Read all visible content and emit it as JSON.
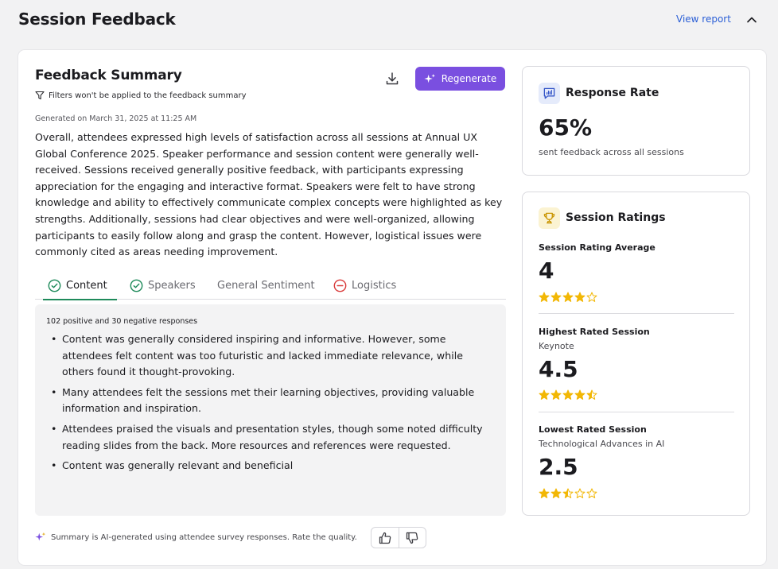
{
  "header": {
    "title": "Session Feedback",
    "view_report": "View report",
    "collapse_icon": "chevron-up-icon"
  },
  "summary": {
    "title": "Feedback Summary",
    "filter_note": "Filters won't be applied to the feedback summary",
    "download_icon": "download-icon",
    "regenerate_label": "Regenerate",
    "generated_on": "Generated on March 31, 2025 at 11:25 AM",
    "text": "Overall, attendees expressed high levels of satisfaction across all sessions at Annual UX Global Conference 2025. Speaker performance and session content were generally well-received. Sessions received generally positive feedback, with participants expressing appreciation for the engaging and interactive format. Speakers were felt to have strong knowledge and ability to effectively communicate complex concepts were highlighted as key strengths. Additionally, sessions had clear objectives and were well-organized, allowing participants to easily follow along and grasp the content. However, logistical issues were commonly cited as areas needing improvement."
  },
  "tabs": [
    {
      "label": "Content",
      "status": "positive",
      "active": true
    },
    {
      "label": "Speakers",
      "status": "positive",
      "active": false
    },
    {
      "label": "General Sentiment",
      "status": "none",
      "active": false
    },
    {
      "label": "Logistics",
      "status": "negative",
      "active": false
    }
  ],
  "detail": {
    "response_count": "102 positive and 30 negative responses",
    "bullets": [
      "Content was generally considered inspiring and informative. However, some attendees felt content was too futuristic and lacked immediate relevance, while others found it thought-provoking.",
      "Many attendees felt the sessions met their learning objectives, providing valuable information and inspiration.",
      "Attendees praised the visuals and presentation styles, though some noted difficulty reading slides from the back. More resources and references were requested.",
      "Content was generally relevant and beneficial"
    ]
  },
  "footer": {
    "ai_note": "Summary is AI-generated using attendee survey responses. Rate the quality."
  },
  "response_rate": {
    "title": "Response Rate",
    "value": "65%",
    "caption": "sent feedback across all sessions"
  },
  "session_ratings": {
    "title": "Session Ratings",
    "average_label": "Session Rating Average",
    "average_value": "4",
    "average_stars": 4,
    "highest_label": "Highest Rated Session",
    "highest_session": "Keynote",
    "highest_value": "4.5",
    "highest_stars": 4.5,
    "lowest_label": "Lowest Rated Session",
    "lowest_session": "Technological Advances in AI",
    "lowest_value": "2.5",
    "lowest_stars": 2.5
  },
  "colors": {
    "accent": "#7a4fe0",
    "link": "#2b5fd6",
    "positive": "#1e8a5a",
    "negative": "#d93a3a",
    "star": "#f2b705"
  }
}
